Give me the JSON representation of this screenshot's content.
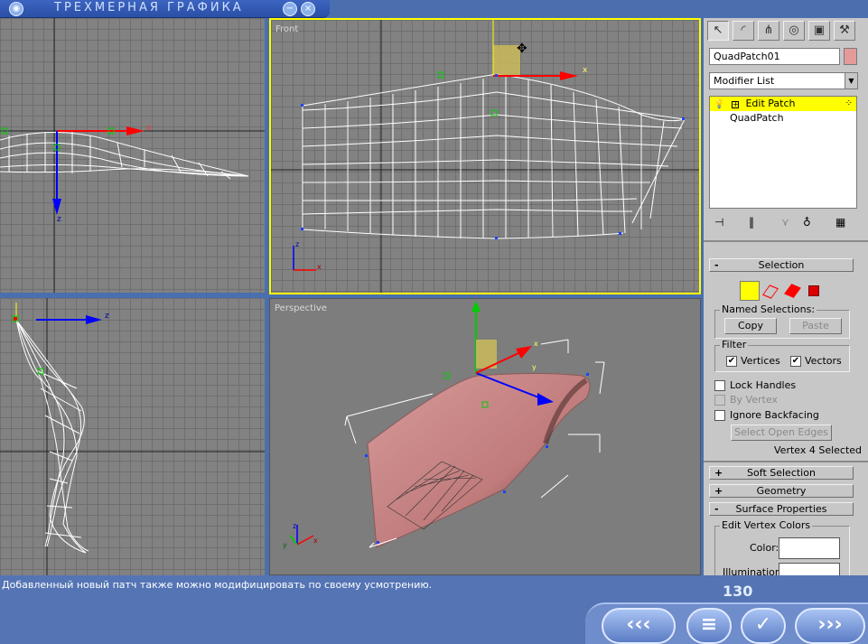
{
  "window": {
    "title": "ТРЕХМЕРНАЯ ГРАФИКА",
    "minimize_glyph": "−",
    "close_glyph": "×"
  },
  "viewports": {
    "front_label": "Front",
    "perspective_label": "Perspective",
    "axis_x": "x",
    "axis_y": "y",
    "axis_z": "z"
  },
  "panel": {
    "object_name": "QuadPatch01",
    "object_color": "#e59a9a",
    "modifier_list": "Modifier List",
    "stack": [
      {
        "label": "Edit Patch",
        "selected": true
      },
      {
        "label": "QuadPatch",
        "selected": false
      }
    ],
    "selection": {
      "title": "Selection",
      "named_selections": "Named Selections:",
      "copy": "Copy",
      "paste": "Paste",
      "filter": "Filter",
      "vertices": "Vertices",
      "vectors": "Vectors",
      "lock_handles": "Lock Handles",
      "by_vertex": "By Vertex",
      "ignore_backfacing": "Ignore Backfacing",
      "select_open_edges": "Select Open Edges",
      "status": "Vertex 4 Selected"
    },
    "soft_selection": "Soft Selection",
    "geometry": "Geometry",
    "surface_properties": "Surface Properties",
    "edit_vertex_colors": "Edit Vertex Colors",
    "color_label": "Color:",
    "illumination_label": "Illumination:",
    "plus": "+",
    "minus": "-"
  },
  "status": {
    "message": "Добавленный новый патч также можно модифицировать по своему усмотрению.",
    "page_number": "130"
  },
  "nav": {
    "back": "‹‹‹",
    "menu": "≡",
    "ok": "✓",
    "forward": "›››"
  }
}
